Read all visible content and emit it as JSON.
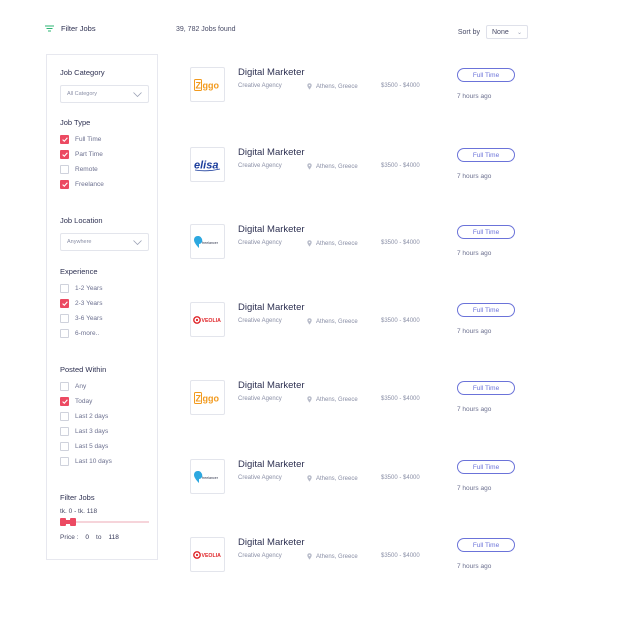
{
  "header": {
    "filter_label": "Filter Jobs",
    "found_text": "39, 782 Jobs found",
    "sort_label": "Sort by",
    "sort_value": "None"
  },
  "sidebar": {
    "category": {
      "title": "Job Category",
      "value": "All Category"
    },
    "job_type": {
      "title": "Job Type",
      "options": [
        {
          "label": "Full Time",
          "checked": true
        },
        {
          "label": "Part Time",
          "checked": true
        },
        {
          "label": "Remote",
          "checked": false
        },
        {
          "label": "Freelance",
          "checked": true
        }
      ]
    },
    "location": {
      "title": "Job Location",
      "value": "Anywhere"
    },
    "experience": {
      "title": "Experience",
      "options": [
        {
          "label": "1-2 Years",
          "checked": false
        },
        {
          "label": "2-3 Years",
          "checked": true
        },
        {
          "label": "3-6 Years",
          "checked": false
        },
        {
          "label": "6-more..",
          "checked": false
        }
      ]
    },
    "posted": {
      "title": "Posted Within",
      "options": [
        {
          "label": "Any",
          "checked": false
        },
        {
          "label": "Today",
          "checked": true
        },
        {
          "label": "Last 2 days",
          "checked": false
        },
        {
          "label": "Last 3 days",
          "checked": false
        },
        {
          "label": "Last 5 days",
          "checked": false
        },
        {
          "label": "Last 10 days",
          "checked": false
        }
      ]
    },
    "price_filter": {
      "title": "Filter Jobs",
      "range_text": "tk. 0 - tk. 118",
      "price_label": "Price :",
      "min": "0",
      "to_label": "to",
      "max": "118"
    }
  },
  "jobs": [
    {
      "logo": "ziggo-logo",
      "logo_text": "Ziggo",
      "title": "Digital Marketer",
      "company": "Creative Agency",
      "location": "Athens, Greece",
      "salary": "$3500 - $4000",
      "type": "Full Time",
      "posted": "7 hours ago"
    },
    {
      "logo": "elisa-logo",
      "logo_text": "elisa",
      "title": "Digital Marketer",
      "company": "Creative Agency",
      "location": "Athens, Greece",
      "salary": "$3500 - $4000",
      "type": "Full Time",
      "posted": "7 hours ago"
    },
    {
      "logo": "freelancer-logo",
      "logo_text": "Freelancer",
      "title": "Digital Marketer",
      "company": "Creative Agency",
      "location": "Athens, Greece",
      "salary": "$3500 - $4000",
      "type": "Full Time",
      "posted": "7 hours ago"
    },
    {
      "logo": "veolia-logo",
      "logo_text": "VEOLIA",
      "title": "Digital Marketer",
      "company": "Creative Agency",
      "location": "Athens, Greece",
      "salary": "$3500 - $4000",
      "type": "Full Time",
      "posted": "7 hours ago"
    },
    {
      "logo": "ziggo-logo",
      "logo_text": "Ziggo",
      "title": "Digital Marketer",
      "company": "Creative Agency",
      "location": "Athens, Greece",
      "salary": "$3500 - $4000",
      "type": "Full Time",
      "posted": "7 hours ago"
    },
    {
      "logo": "freelancer-logo",
      "logo_text": "Freelancer",
      "title": "Digital Marketer",
      "company": "Creative Agency",
      "location": "Athens, Greece",
      "salary": "$3500 - $4000",
      "type": "Full Time",
      "posted": "7 hours ago"
    },
    {
      "logo": "veolia-logo",
      "logo_text": "VEOLIA",
      "title": "Digital Marketer",
      "company": "Creative Agency",
      "location": "Athens, Greece",
      "salary": "$3500 - $4000",
      "type": "Full Time",
      "posted": "7 hours ago"
    }
  ],
  "colors": {
    "accent": "#ec4a62",
    "badge": "#6b73d9",
    "filter_icon": "#2bb673"
  }
}
